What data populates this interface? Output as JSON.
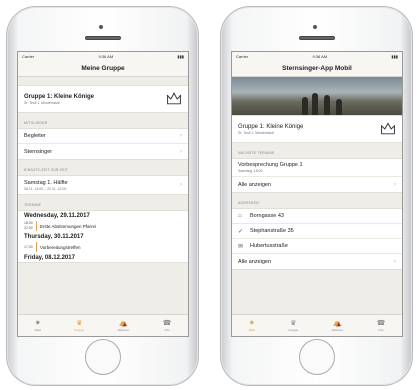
{
  "status": {
    "carrier": "Carrier",
    "time": "9:36 AM",
    "battery": "▮▮▮"
  },
  "left": {
    "title": "Meine Gruppe",
    "group": {
      "name": "Gruppe 1: Kleine Könige",
      "subtitle": "St. Teoll 1, Musterstadt"
    },
    "mitglieder_header": "Mitglieder",
    "members": [
      {
        "label": "Begleiter"
      },
      {
        "label": "Sternsinger"
      }
    ],
    "einsatz_header": "Einsatz-Zeit zur Zeit",
    "einsatz": {
      "title": "Samstag 1. Hälfte",
      "subtitle": "28.11. 14:00 – 22.11. 12:00"
    },
    "termine_header": "Termine",
    "days": [
      {
        "date": "Wednesday, 29.11.2017",
        "events": [
          {
            "time": "18:00\n22:00",
            "title": "Erste Abstimmungen Pfarrei"
          }
        ]
      },
      {
        "date": "Thursday, 30.11.2017",
        "events": [
          {
            "time": "17:00",
            "title": "Vorbereitungstreffen"
          }
        ]
      },
      {
        "date": "Friday, 08.12.2017",
        "events": []
      }
    ]
  },
  "right": {
    "title": "Sternsinger-App Mobil",
    "group": {
      "name": "Gruppe 1: Kleine Könige",
      "subtitle": "St. Teoll 1, Musterstadt"
    },
    "termine_header": "Nächste Termine",
    "termin": {
      "title": "Vorbesprechung Gruppe 1",
      "subtitle": "Samstag, 18:00"
    },
    "termine_all": "Alle anzeigen",
    "addresses_header": "Adressen",
    "addresses": [
      {
        "icon": "home-icon",
        "label": "Borngasse 43"
      },
      {
        "icon": "check-icon",
        "label": "Stephanstraße 35"
      },
      {
        "icon": "mail-icon",
        "label": "Hubertusstraße"
      }
    ],
    "addresses_all": "Alle anzeigen"
  },
  "tabs": [
    {
      "icon": "star-icon",
      "label": "Start"
    },
    {
      "icon": "crown-icon",
      "label": "Gruppe"
    },
    {
      "icon": "tent-icon",
      "label": "Aktionen"
    },
    {
      "icon": "phone-icon",
      "label": "Info"
    }
  ],
  "colors": {
    "accent": "#e0a24a",
    "background": "#efede8"
  }
}
